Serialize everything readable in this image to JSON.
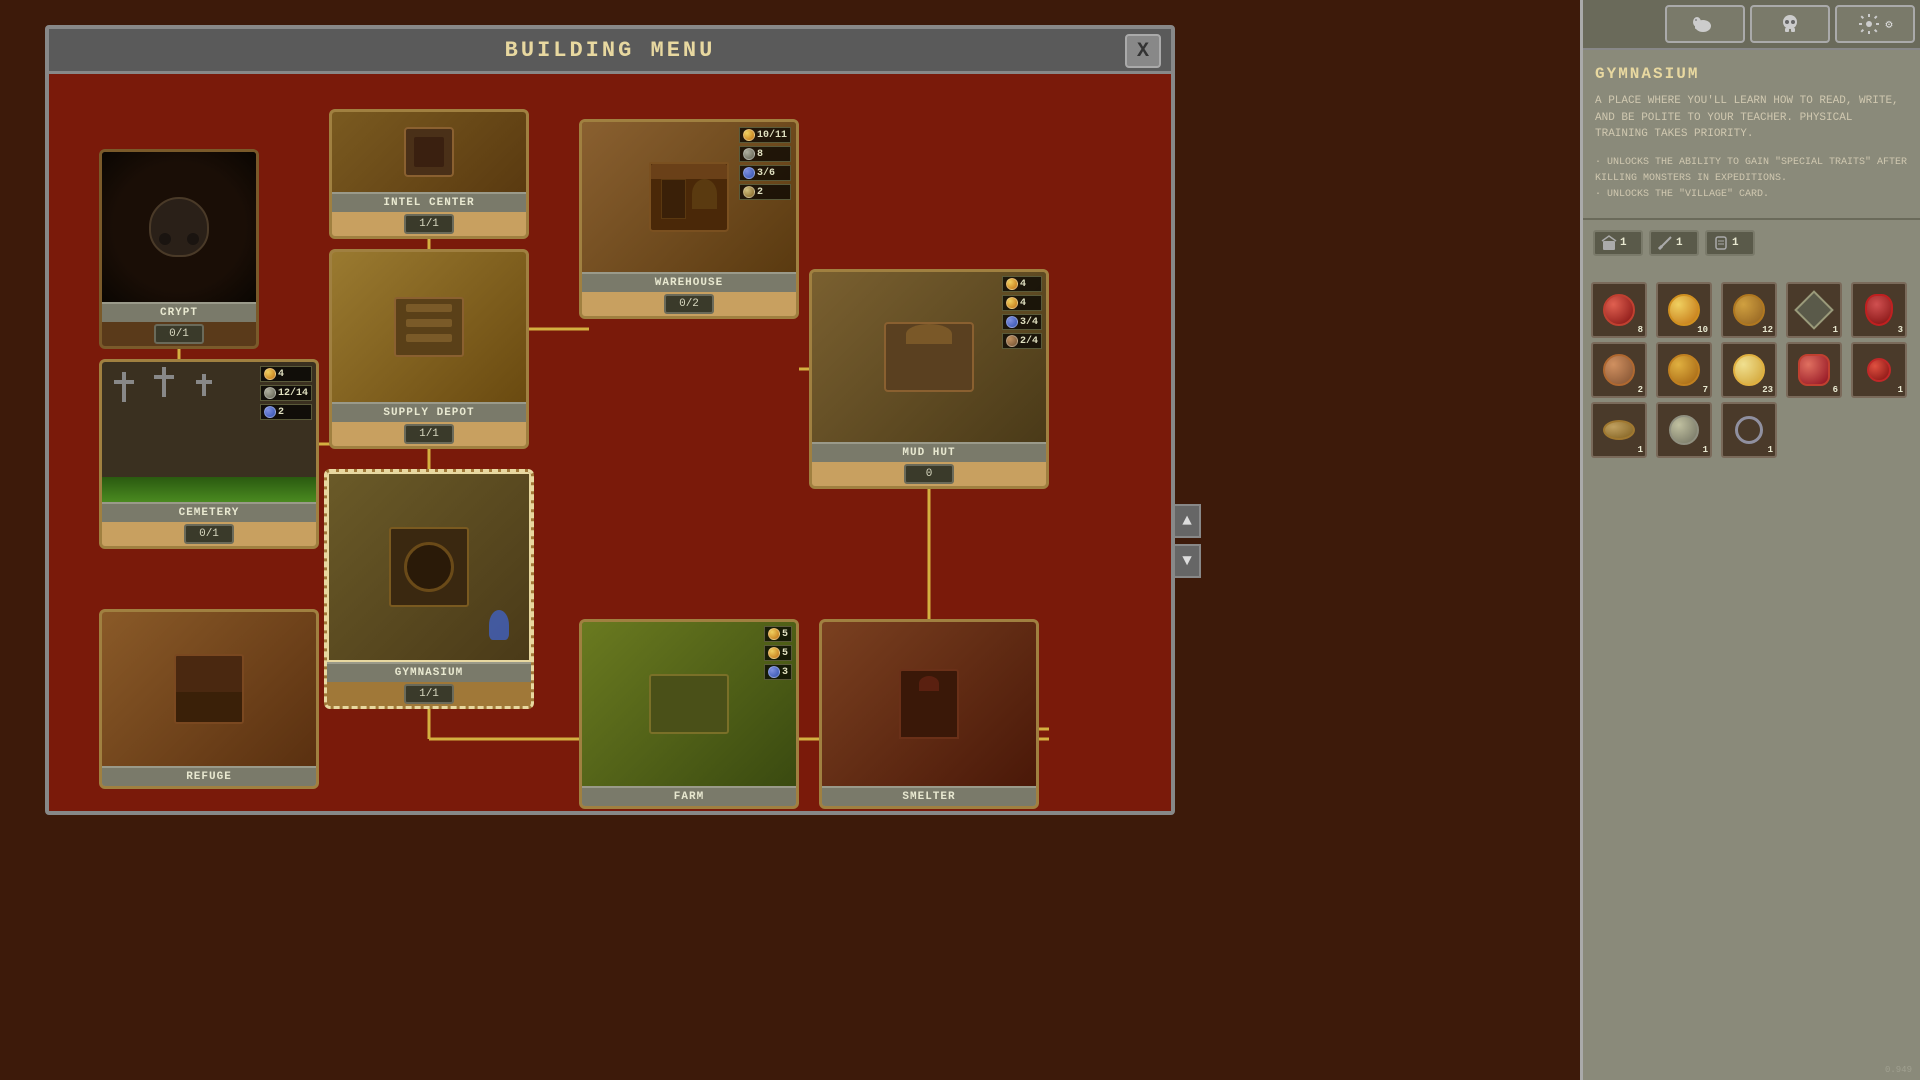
{
  "window": {
    "title": "BUILDING MENU",
    "close_label": "X"
  },
  "top_bar": {
    "btn1_icon": "elephant",
    "btn2_icon": "skull",
    "btn3_icon": "gear"
  },
  "buildings": {
    "crypt": {
      "name": "CRYPT",
      "counter": "0/1"
    },
    "cemetery": {
      "name": "CEMETERY",
      "counter": "0/1",
      "res1_val": "4",
      "res2_val": "12/14",
      "res3_val": "2"
    },
    "intel_center": {
      "name": "INTEL CENTER",
      "counter": "1/1"
    },
    "supply_depot": {
      "name": "SUPPLY DEPOT",
      "counter": "1/1"
    },
    "gymnasium": {
      "name": "GYMNASIUM",
      "counter": "1/1"
    },
    "warehouse": {
      "name": "WAREHOUSE",
      "counter": "0/2",
      "res1_val": "10/11",
      "res2_val": "8",
      "res3_val": "3/6",
      "res4_val": "2"
    },
    "mud_hut": {
      "name": "MUD HUT",
      "counter": "0",
      "res1_val": "4",
      "res2_val": "4",
      "res3_val": "3/4",
      "res4_val": "2/4"
    },
    "refuge": {
      "name": "REFUGE"
    },
    "farm": {
      "name": "FARM",
      "res1_val": "5",
      "res2_val": "5",
      "res3_val": "3"
    },
    "smelter": {
      "name": "SMELTER"
    }
  },
  "info_panel": {
    "title": "GYMNASIUM",
    "description": "A PLACE WHERE YOU'LL LEARN HOW TO READ, WRITE, AND BE POLITE TO YOUR TEACHER. PHYSICAL TRAINING TAKES PRIORITY.",
    "bullets": [
      "· UNLOCKS THE ABILITY TO GAIN \"SPECIAL TRAITS\" AFTER KILLING MONSTERS IN EXPEDITIONS.",
      "· UNLOCKS THE \"VILLAGE\" CARD."
    ],
    "res_row1": [
      {
        "icon": "building",
        "count": "1"
      },
      {
        "icon": "sword",
        "count": "1"
      },
      {
        "icon": "scroll",
        "count": "1"
      }
    ],
    "inventory": [
      {
        "icon": "red_circle",
        "count": "8"
      },
      {
        "icon": "amber_circle",
        "count": "10"
      },
      {
        "icon": "amber_dark",
        "count": "12"
      },
      {
        "icon": "spike",
        "count": "1"
      },
      {
        "icon": "red_gem",
        "count": "3"
      },
      {
        "icon": "brown_circle",
        "count": "2"
      },
      {
        "icon": "amber_big",
        "count": "7"
      },
      {
        "icon": "light_amber",
        "count": "23"
      },
      {
        "icon": "shield_red",
        "count": "6"
      },
      {
        "icon": "small_red",
        "count": "1"
      },
      {
        "icon": "curved_blade",
        "count": "1"
      },
      {
        "icon": "orb",
        "count": "1"
      },
      {
        "icon": "ring",
        "count": "1"
      }
    ]
  },
  "version": "0.949",
  "scroll": {
    "up_label": "▲",
    "down_label": "▼"
  }
}
